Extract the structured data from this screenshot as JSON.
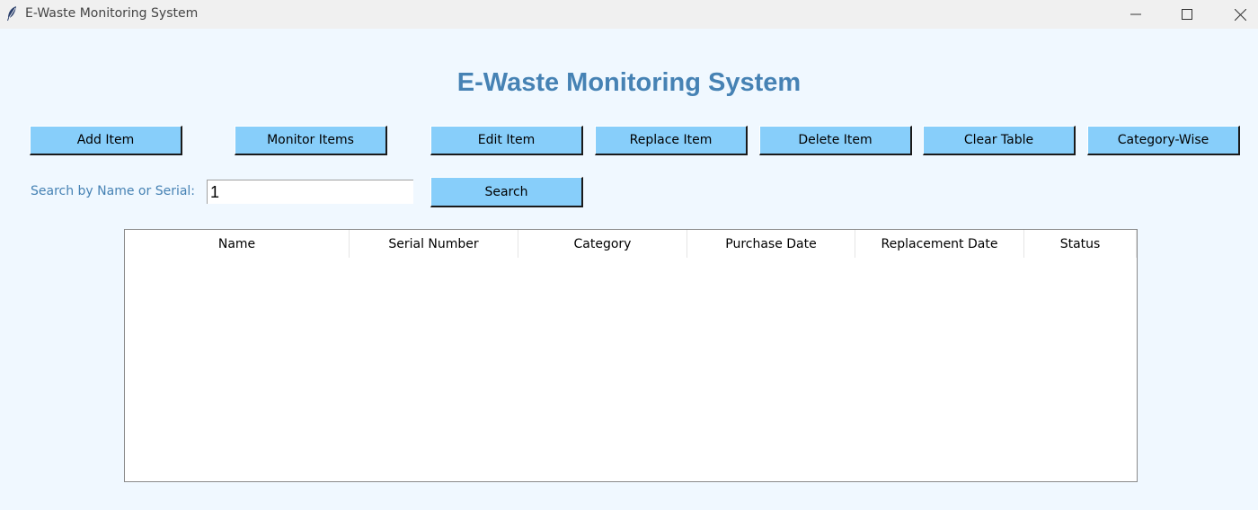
{
  "window": {
    "title": "E-Waste Monitoring System"
  },
  "heading": "E-Waste Monitoring System",
  "toolbar": {
    "add_item": "Add Item",
    "monitor_items": "Monitor Items",
    "edit_item": "Edit Item",
    "replace_item": "Replace Item",
    "delete_item": "Delete Item",
    "clear_table": "Clear Table",
    "category_wise": "Category-Wise"
  },
  "search": {
    "label": "Search by Name or Serial:",
    "value": "1",
    "button": "Search"
  },
  "table": {
    "columns": [
      "Name",
      "Serial Number",
      "Category",
      "Purchase Date",
      "Replacement Date",
      "Status"
    ],
    "rows": []
  },
  "colors": {
    "background": "#f0f8ff",
    "button": "#87cefa",
    "heading": "#4682b4"
  },
  "icons": {
    "app": "feather-icon",
    "minimize": "minimize-icon",
    "maximize": "maximize-icon",
    "close": "close-icon"
  }
}
